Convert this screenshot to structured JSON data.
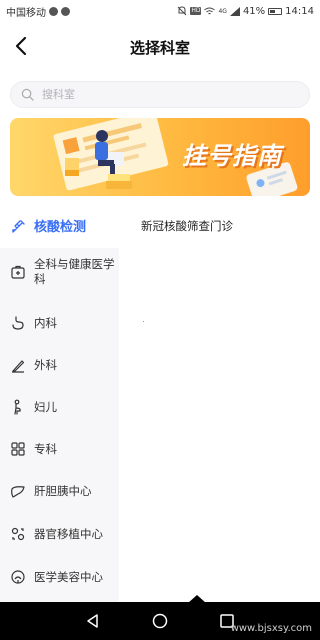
{
  "status_bar": {
    "carrier": "中国移动",
    "battery": "41%",
    "time": "14:14",
    "network": "4G",
    "hd": "HD"
  },
  "header": {
    "title": "选择科室"
  },
  "search": {
    "placeholder": "搜科室",
    "value": ""
  },
  "banner": {
    "title": "挂号指南"
  },
  "sidebar": {
    "items": [
      {
        "label": "核酸检测",
        "icon": "syringe-icon",
        "active": true
      },
      {
        "label": "全科与健康医学科",
        "icon": "medical-kit-icon",
        "active": false
      },
      {
        "label": "内科",
        "icon": "stomach-icon",
        "active": false
      },
      {
        "label": "外科",
        "icon": "scalpel-icon",
        "active": false
      },
      {
        "label": "妇儿",
        "icon": "pregnant-icon",
        "active": false
      },
      {
        "label": "专科",
        "icon": "grid-icon",
        "active": false
      },
      {
        "label": "肝胆胰中心",
        "icon": "liver-icon",
        "active": false
      },
      {
        "label": "器官移植中心",
        "icon": "organ-icon",
        "active": false
      },
      {
        "label": "医学美容中心",
        "icon": "face-icon",
        "active": false
      }
    ]
  },
  "content": {
    "items": [
      "新冠核酸筛查门诊"
    ]
  },
  "watermark": "www.bjsxsy.com",
  "colors": {
    "accent": "#3a6ff5",
    "banner_start": "#ffd76a",
    "banner_end": "#ff9e2c"
  }
}
